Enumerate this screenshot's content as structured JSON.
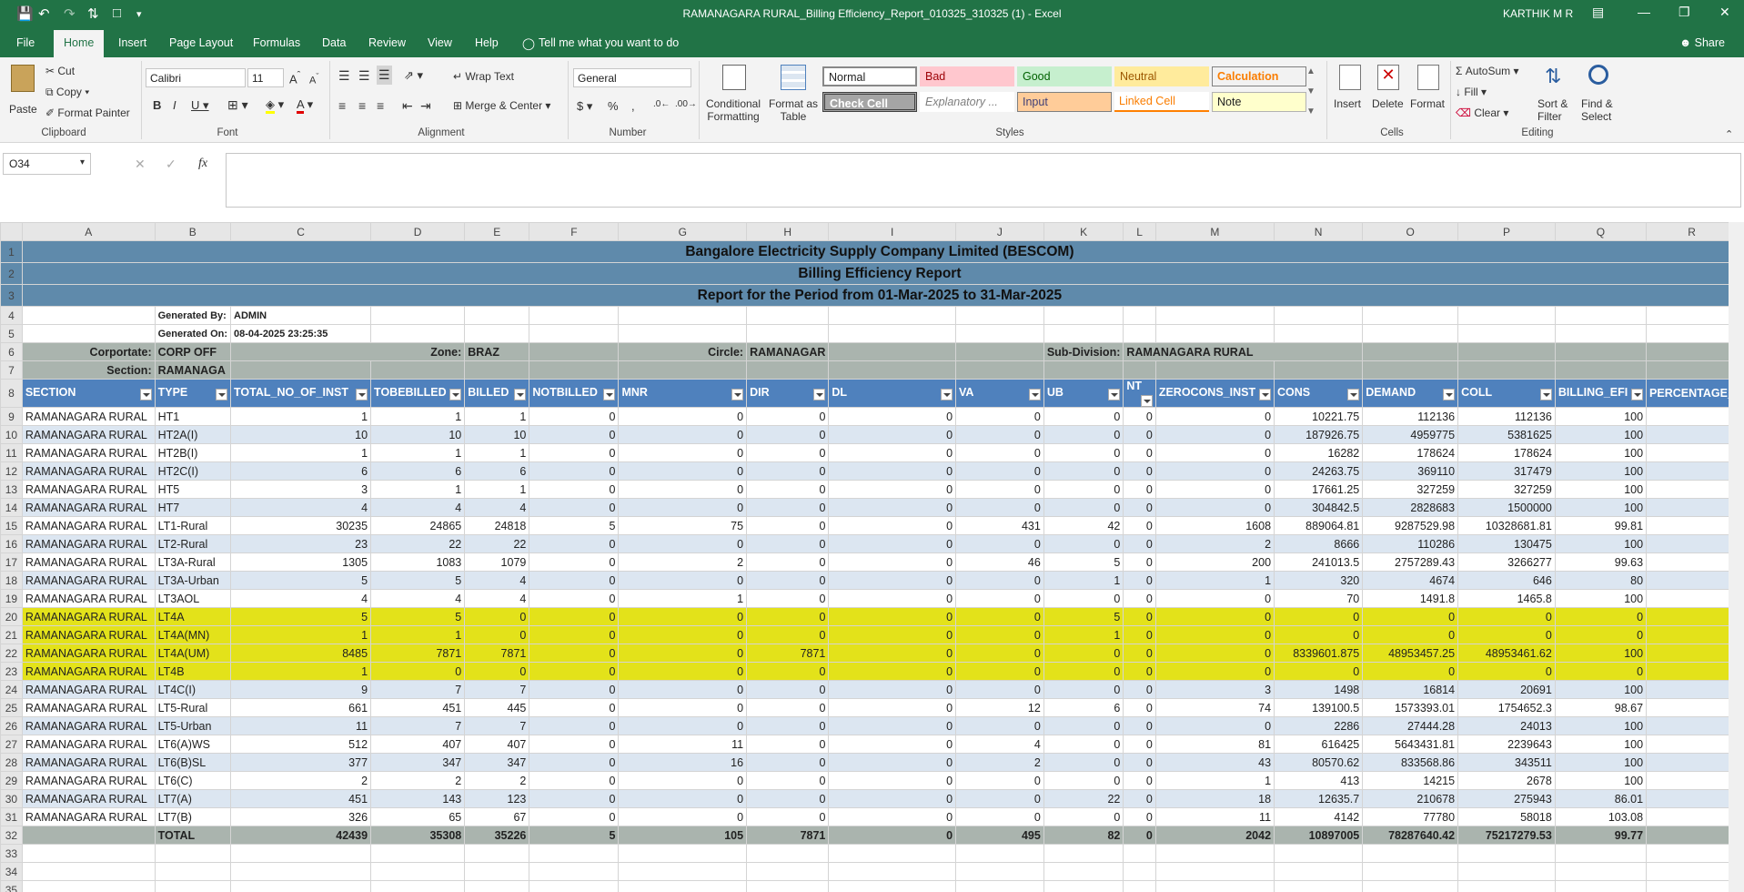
{
  "window": {
    "title": "RAMANAGARA RURAL_Billing Efficiency_Report_010325_310325 (1)  -  Excel",
    "user": "KARTHIK M R"
  },
  "tabs": [
    "File",
    "Home",
    "Insert",
    "Page Layout",
    "Formulas",
    "Data",
    "Review",
    "View",
    "Help"
  ],
  "tell_me": "Tell me what you want to do",
  "share": "Share",
  "ribbon": {
    "clipboard": {
      "paste": "Paste",
      "cut": "Cut",
      "copy": "Copy",
      "format_painter": "Format Painter",
      "group": "Clipboard"
    },
    "font": {
      "name": "Calibri",
      "size": "11",
      "group": "Font"
    },
    "alignment": {
      "wrap": "Wrap Text",
      "merge": "Merge & Center",
      "group": "Alignment"
    },
    "number": {
      "format": "General",
      "group": "Number"
    },
    "styles": {
      "cond1": "Conditional",
      "cond2": "Formatting",
      "fmt1": "Format as",
      "fmt2": "Table",
      "group": "Styles",
      "items": [
        "Normal",
        "Bad",
        "Good",
        "Neutral",
        "Calculation",
        "Check Cell",
        "Explanatory ...",
        "Input",
        "Linked Cell",
        "Note"
      ]
    },
    "cells": {
      "insert": "Insert",
      "delete": "Delete",
      "format": "Format",
      "group": "Cells"
    },
    "editing": {
      "autosum": "AutoSum",
      "fill": "Fill",
      "clear": "Clear",
      "sort1": "Sort &",
      "sort2": "Filter",
      "find1": "Find &",
      "find2": "Select",
      "group": "Editing"
    }
  },
  "namebox": "O34",
  "fx": "fx",
  "col_letters": [
    "A",
    "B",
    "C",
    "D",
    "E",
    "F",
    "G",
    "H",
    "I",
    "J",
    "K",
    "L",
    "M",
    "N",
    "O",
    "P",
    "Q",
    "R"
  ],
  "report": {
    "title1": "Bangalore Electricity Supply Company Limited (BESCOM)",
    "title2": "Billing Efficiency Report",
    "title3": "Report for the Period from 01-Mar-2025 to 31-Mar-2025",
    "generated_by_label": "Generated By:",
    "generated_by": "ADMIN",
    "generated_on_label": "Generated On:",
    "generated_on": "08-04-2025 23:25:35",
    "corporate_label": "Corportate:",
    "corporate": "CORP OFF",
    "zone_label": "Zone:",
    "zone": "BRAZ",
    "circle_label": "Circle:",
    "circle": "RAMANAGAR",
    "subdiv_label": "Sub-Division:",
    "subdiv": "RAMANAGARA RURAL",
    "section_label": "Section:",
    "section": "RAMANAGA"
  },
  "headers": [
    "SECTION",
    "TYPE",
    "TOTAL_NO_OF_INST",
    "TOBEBILLED",
    "BILLED",
    "NOTBILLED",
    "MNR",
    "DIR",
    "DL",
    "VA",
    "UB",
    "NT",
    "ZEROCONS_INST",
    "CONS",
    "DEMAND",
    "COLL",
    "BILLING_EFI",
    "PERCENTAGE_"
  ],
  "rows": [
    [
      "RAMANAGARA RURAL",
      "HT1",
      "1",
      "1",
      "1",
      "0",
      "0",
      "0",
      "0",
      "0",
      "0",
      "0",
      "0",
      "10221.75",
      "112136",
      "112136",
      "100"
    ],
    [
      "RAMANAGARA RURAL",
      "HT2A(I)",
      "10",
      "10",
      "10",
      "0",
      "0",
      "0",
      "0",
      "0",
      "0",
      "0",
      "0",
      "187926.75",
      "4959775",
      "5381625",
      "100"
    ],
    [
      "RAMANAGARA RURAL",
      "HT2B(I)",
      "1",
      "1",
      "1",
      "0",
      "0",
      "0",
      "0",
      "0",
      "0",
      "0",
      "0",
      "16282",
      "178624",
      "178624",
      "100"
    ],
    [
      "RAMANAGARA RURAL",
      "HT2C(I)",
      "6",
      "6",
      "6",
      "0",
      "0",
      "0",
      "0",
      "0",
      "0",
      "0",
      "0",
      "24263.75",
      "369110",
      "317479",
      "100"
    ],
    [
      "RAMANAGARA RURAL",
      "HT5",
      "3",
      "1",
      "1",
      "0",
      "0",
      "0",
      "0",
      "0",
      "0",
      "0",
      "0",
      "17661.25",
      "327259",
      "327259",
      "100"
    ],
    [
      "RAMANAGARA RURAL",
      "HT7",
      "4",
      "4",
      "4",
      "0",
      "0",
      "0",
      "0",
      "0",
      "0",
      "0",
      "0",
      "304842.5",
      "2828683",
      "1500000",
      "100"
    ],
    [
      "RAMANAGARA RURAL",
      "LT1-Rural",
      "30235",
      "24865",
      "24818",
      "5",
      "75",
      "0",
      "0",
      "431",
      "42",
      "0",
      "1608",
      "889064.81",
      "9287529.98",
      "10328681.81",
      "99.81"
    ],
    [
      "RAMANAGARA RURAL",
      "LT2-Rural",
      "23",
      "22",
      "22",
      "0",
      "0",
      "0",
      "0",
      "0",
      "0",
      "0",
      "2",
      "8666",
      "110286",
      "130475",
      "100"
    ],
    [
      "RAMANAGARA RURAL",
      "LT3A-Rural",
      "1305",
      "1083",
      "1079",
      "0",
      "2",
      "0",
      "0",
      "46",
      "5",
      "0",
      "200",
      "241013.5",
      "2757289.43",
      "3266277",
      "99.63"
    ],
    [
      "RAMANAGARA RURAL",
      "LT3A-Urban",
      "5",
      "5",
      "4",
      "0",
      "0",
      "0",
      "0",
      "0",
      "1",
      "0",
      "1",
      "320",
      "4674",
      "646",
      "80"
    ],
    [
      "RAMANAGARA RURAL",
      "LT3AOL",
      "4",
      "4",
      "4",
      "0",
      "1",
      "0",
      "0",
      "0",
      "0",
      "0",
      "0",
      "70",
      "1491.8",
      "1465.8",
      "100"
    ],
    [
      "RAMANAGARA RURAL",
      "LT4A",
      "5",
      "5",
      "0",
      "0",
      "0",
      "0",
      "0",
      "0",
      "5",
      "0",
      "0",
      "0",
      "0",
      "0",
      "0"
    ],
    [
      "RAMANAGARA RURAL",
      "LT4A(MN)",
      "1",
      "1",
      "0",
      "0",
      "0",
      "0",
      "0",
      "0",
      "1",
      "0",
      "0",
      "0",
      "0",
      "0",
      "0"
    ],
    [
      "RAMANAGARA RURAL",
      "LT4A(UM)",
      "8485",
      "7871",
      "7871",
      "0",
      "0",
      "7871",
      "0",
      "0",
      "0",
      "0",
      "0",
      "8339601.875",
      "48953457.25",
      "48953461.62",
      "100"
    ],
    [
      "RAMANAGARA RURAL",
      "LT4B",
      "1",
      "0",
      "0",
      "0",
      "0",
      "0",
      "0",
      "0",
      "0",
      "0",
      "0",
      "0",
      "0",
      "0",
      "0"
    ],
    [
      "RAMANAGARA RURAL",
      "LT4C(I)",
      "9",
      "7",
      "7",
      "0",
      "0",
      "0",
      "0",
      "0",
      "0",
      "0",
      "3",
      "1498",
      "16814",
      "20691",
      "100"
    ],
    [
      "RAMANAGARA RURAL",
      "LT5-Rural",
      "661",
      "451",
      "445",
      "0",
      "0",
      "0",
      "0",
      "12",
      "6",
      "0",
      "74",
      "139100.5",
      "1573393.01",
      "1754652.3",
      "98.67"
    ],
    [
      "RAMANAGARA RURAL",
      "LT5-Urban",
      "11",
      "7",
      "7",
      "0",
      "0",
      "0",
      "0",
      "0",
      "0",
      "0",
      "0",
      "2286",
      "27444.28",
      "24013",
      "100"
    ],
    [
      "RAMANAGARA RURAL",
      "LT6(A)WS",
      "512",
      "407",
      "407",
      "0",
      "11",
      "0",
      "0",
      "4",
      "0",
      "0",
      "81",
      "616425",
      "5643431.81",
      "2239643",
      "100"
    ],
    [
      "RAMANAGARA RURAL",
      "LT6(B)SL",
      "377",
      "347",
      "347",
      "0",
      "16",
      "0",
      "0",
      "2",
      "0",
      "0",
      "43",
      "80570.62",
      "833568.86",
      "343511",
      "100"
    ],
    [
      "RAMANAGARA RURAL",
      "LT6(C)",
      "2",
      "2",
      "2",
      "0",
      "0",
      "0",
      "0",
      "0",
      "0",
      "0",
      "1",
      "413",
      "14215",
      "2678",
      "100"
    ],
    [
      "RAMANAGARA RURAL",
      "LT7(A)",
      "451",
      "143",
      "123",
      "0",
      "0",
      "0",
      "0",
      "0",
      "22",
      "0",
      "18",
      "12635.7",
      "210678",
      "275943",
      "86.01"
    ],
    [
      "RAMANAGARA RURAL",
      "LT7(B)",
      "326",
      "65",
      "67",
      "0",
      "0",
      "0",
      "0",
      "0",
      "0",
      "0",
      "11",
      "4142",
      "77780",
      "58018",
      "103.08"
    ]
  ],
  "total": [
    "",
    "TOTAL",
    "42439",
    "35308",
    "35226",
    "5",
    "105",
    "7871",
    "0",
    "495",
    "82",
    "0",
    "2042",
    "10897005",
    "78287640.42",
    "75217279.53",
    "99.77"
  ]
}
